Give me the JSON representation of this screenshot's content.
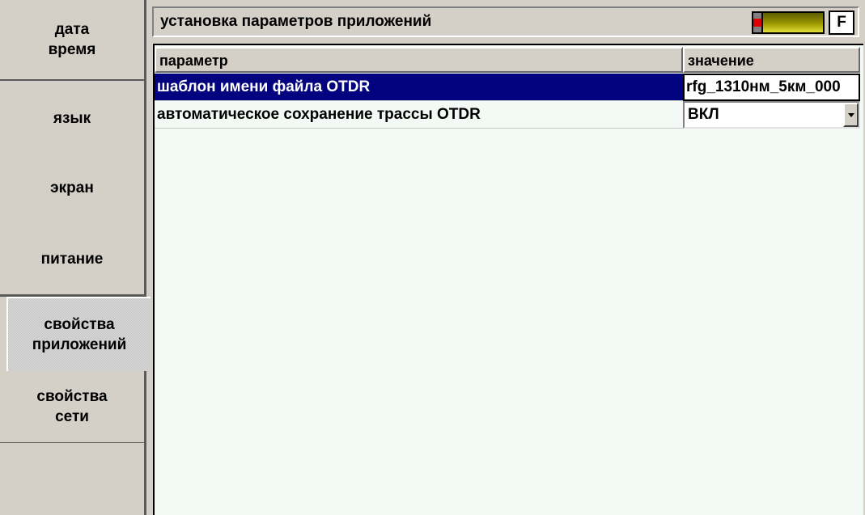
{
  "sidebar": {
    "items": [
      {
        "label": "дата\nвремя",
        "active": false
      },
      {
        "label": "язык",
        "active": false
      },
      {
        "label": "экран",
        "active": false
      },
      {
        "label": "питание",
        "active": false
      },
      {
        "label": "свойства\nприложений",
        "active": true
      },
      {
        "label": "свойства\nсети",
        "active": false
      }
    ]
  },
  "header": {
    "title": "установка параметров приложений",
    "f_key_label": "F",
    "battery_icon": "battery-icon"
  },
  "table": {
    "columns": [
      "параметр",
      "значение"
    ],
    "rows": [
      {
        "parameter": "шаблон имени файла OTDR",
        "value": "rfg_1310нм_5км_000",
        "selected": true,
        "control": "text"
      },
      {
        "parameter": "автоматическое сохранение трассы OTDR",
        "value": "ВКЛ",
        "selected": false,
        "control": "dropdown"
      }
    ]
  },
  "colors": {
    "selection": "#04037f",
    "panel": "#d4d0c8",
    "table_background": "#f3faf5"
  }
}
